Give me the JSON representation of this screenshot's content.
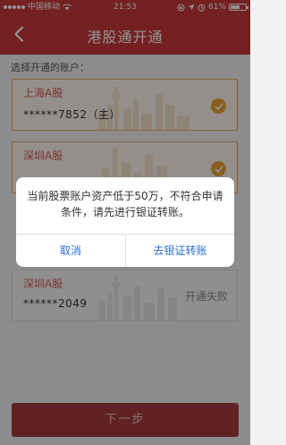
{
  "status_bar": {
    "carrier": "中国移动",
    "time": "21:53",
    "battery": "61%",
    "battery_level": 0.61
  },
  "nav": {
    "title": "港股通开通"
  },
  "section_label": "选择开通的账户：",
  "accounts": [
    {
      "market": "上海A股",
      "number": "******7852（主）",
      "selected": true
    },
    {
      "market": "深圳A股",
      "number": "",
      "selected": true
    },
    {
      "market": "深圳A股",
      "number": "******2049",
      "status": "开通失败"
    }
  ],
  "dialog": {
    "message": "当前股票账户资产低于50万，不符合申请条件，请先进行银证转账。",
    "cancel_label": "取消",
    "confirm_label": "去银证转账"
  },
  "next_button_label": "下一步",
  "colors": {
    "brand_red": "#c9383a",
    "accent_orange": "#f0a030",
    "link_blue": "#2b6fd6"
  }
}
